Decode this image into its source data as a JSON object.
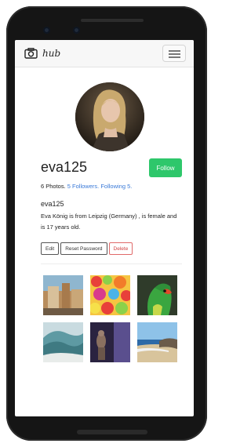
{
  "app": {
    "brand": "hub"
  },
  "profile": {
    "username": "eva125",
    "follow_label": "Follow",
    "photos": "6 Photos.",
    "followers": "5 Followers.",
    "following": "Following 5."
  },
  "bio": {
    "name": "eva125",
    "text": "Eva König is from Leipzig (Germany) , is female and is 17 years old."
  },
  "actions": {
    "edit": "Edit",
    "reset_password": "Reset Password",
    "delete": "Delete"
  },
  "colors": {
    "follow": "#2ec76b",
    "link": "#3a7ad8",
    "delete": "#d14444"
  },
  "icons": [
    "camera-logo-icon",
    "hamburger-menu-icon"
  ]
}
